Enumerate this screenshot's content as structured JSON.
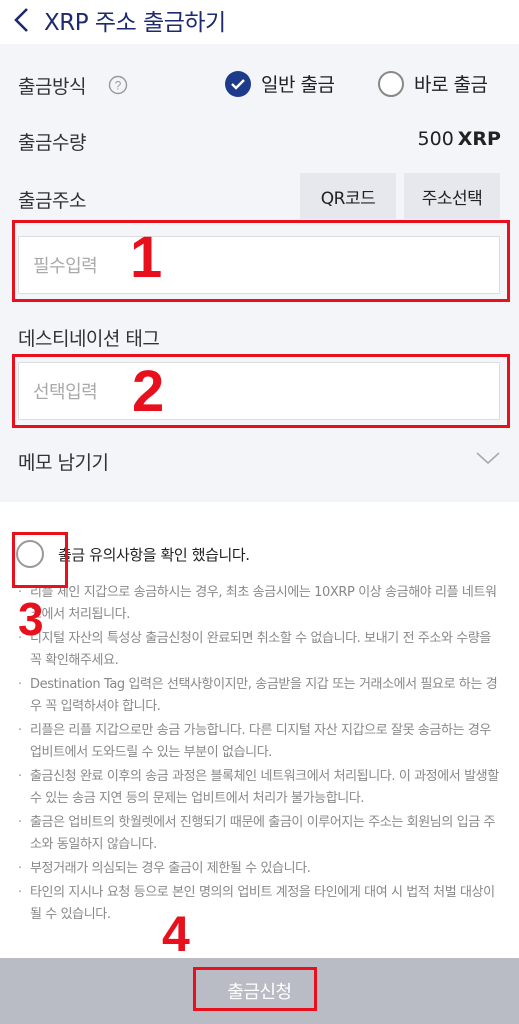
{
  "header": {
    "title": "XRP 주소 출금하기"
  },
  "form": {
    "method_label": "출금방식",
    "method_options": [
      {
        "label": "일반 출금",
        "selected": true
      },
      {
        "label": "바로 출금",
        "selected": false
      }
    ],
    "amount_label": "출금수량",
    "amount_value": "500",
    "amount_unit": "XRP",
    "address_label": "출금주소",
    "qr_button": "QR코드",
    "address_select_button": "주소선택",
    "address_placeholder": "필수입력",
    "tag_label": "데스티네이션 태그",
    "tag_placeholder": "선택입력",
    "memo_label": "메모 남기기"
  },
  "notice": {
    "confirm_label": "출금 유의사항을 확인 했습니다.",
    "items": [
      "리플 체인 지갑으로 송금하시는 경우, 최초 송금시에는 10XRP 이상 송금해야 리플 네트워크에서 처리됩니다.",
      "디지털 자산의 특성상 출금신청이 완료되면 취소할 수 없습니다. 보내기 전 주소와 수량을 꼭 확인해주세요.",
      "Destination Tag 입력은 선택사항이지만, 송금받을 지갑 또는 거래소에서 필요로 하는 경우 꼭 입력하셔야 합니다.",
      "리플은 리플 지갑으로만 송금 가능합니다. 다른 디지털 자산 지갑으로 잘못 송금하는 경우 업비트에서 도와드릴 수 있는 부분이 없습니다.",
      "출금신청 완료 이후의 송금 과정은 블록체인 네트워크에서 처리됩니다. 이 과정에서 발생할 수 있는 송금 지연 등의 문제는 업비트에서 처리가 불가능합니다.",
      "출금은 업비트의 핫월렛에서 진행되기 때문에 출금이 이루어지는 주소는 회원님의 입금 주소와 동일하지 않습니다.",
      "부정거래가 의심되는 경우 출금이 제한될 수 있습니다.",
      "타인의 지시나 요청 등으로 본인 명의의 업비트 계정을 타인에게 대여 시 법적 처벌 대상이 될 수 있습니다."
    ]
  },
  "footer": {
    "submit_label": "출금신청"
  },
  "annotations": {
    "n1": "1",
    "n2": "2",
    "n3": "3",
    "n4": "4"
  },
  "colors": {
    "accent": "#1e3a8a",
    "highlight": "#e8101c",
    "submit_bg": "#b9bcc4"
  }
}
